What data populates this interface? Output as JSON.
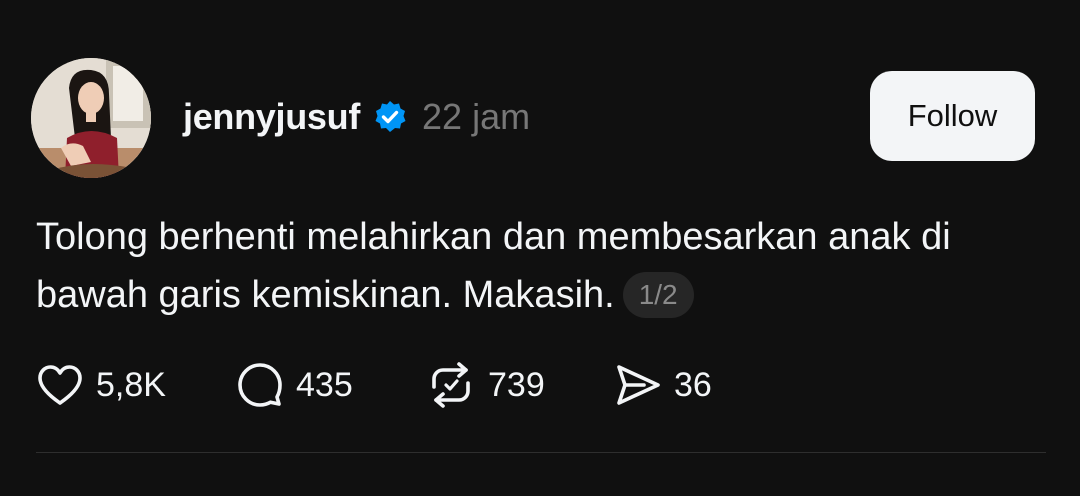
{
  "post": {
    "username": "jennyjusuf",
    "verified_icon": "verified-badge-icon",
    "timestamp": "22 jam",
    "follow_label": "Follow",
    "text": "Tolong berhenti melahirkan dan membesarkan anak di bawah garis kemiskinan. Makasih.",
    "page_indicator": "1/2",
    "actions": {
      "likes": {
        "icon": "heart-icon",
        "count": "5,8K"
      },
      "comments": {
        "icon": "comment-icon",
        "count": "435"
      },
      "reposts": {
        "icon": "repost-icon",
        "count": "739"
      },
      "shares": {
        "icon": "send-icon",
        "count": "36"
      }
    }
  },
  "colors": {
    "background": "#101010",
    "text": "#f3f5f7",
    "muted": "#777777",
    "verified_blue": "#0095f6",
    "button_bg": "#f3f5f7"
  }
}
